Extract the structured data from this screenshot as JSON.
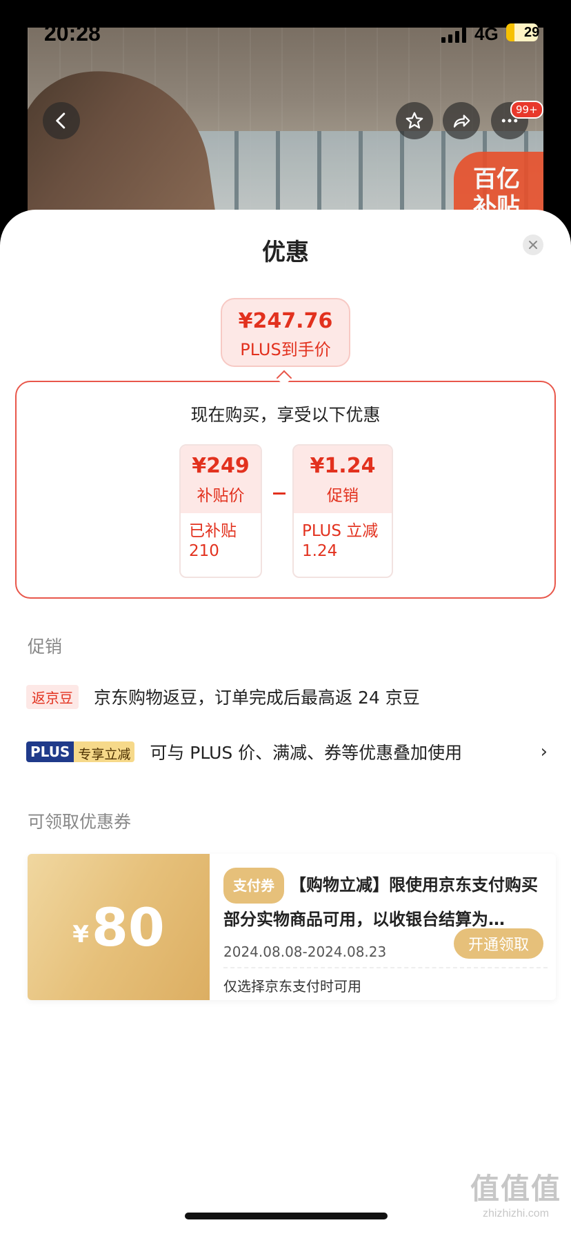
{
  "status_bar": {
    "time": "20:28",
    "network": "4G",
    "battery": "29"
  },
  "top_overlay": {
    "badge_count": "99+",
    "brand_badge_line1": "百亿",
    "brand_badge_line2": "补贴"
  },
  "sheet": {
    "title": "优惠",
    "final_price": {
      "amount": "¥247.76",
      "label": "PLUS到手价"
    },
    "breakdown": {
      "heading": "现在购买，享受以下优惠",
      "cards": [
        {
          "value": "¥249",
          "label": "补贴价",
          "detail_line1": "已补贴",
          "detail_line2": "210"
        },
        {
          "value": "¥1.24",
          "label": "促销",
          "detail_line1": "PLUS 立减",
          "detail_line2": "1.24"
        }
      ]
    },
    "promotions": {
      "section_label": "促销",
      "items": [
        {
          "tag": "返京豆",
          "text": "京东购物返豆，订单完成后最高返 24 京豆"
        },
        {
          "tag_a": "PLUS",
          "tag_b": "专享立减",
          "text": "可与 PLUS 价、满减、券等优惠叠加使用",
          "chevron": "›"
        }
      ]
    },
    "coupons": {
      "section_label": "可领取优惠券",
      "items": [
        {
          "currency": "¥",
          "amount": "80",
          "tag": "支付券",
          "title": "【购物立减】限使用京东支付购买部分实物商品可用，以收银台结算为…",
          "date_range": "2024.08.08-2024.08.23",
          "button": "开通领取",
          "note": "仅选择京东支付时可用"
        }
      ]
    }
  },
  "watermark": {
    "logo": "值值值",
    "site": "zhizhizhi.com"
  },
  "colors": {
    "accent_red": "#e2311e",
    "coupon_gold": "#e6c07a",
    "plus_blue": "#1f3a8a"
  }
}
